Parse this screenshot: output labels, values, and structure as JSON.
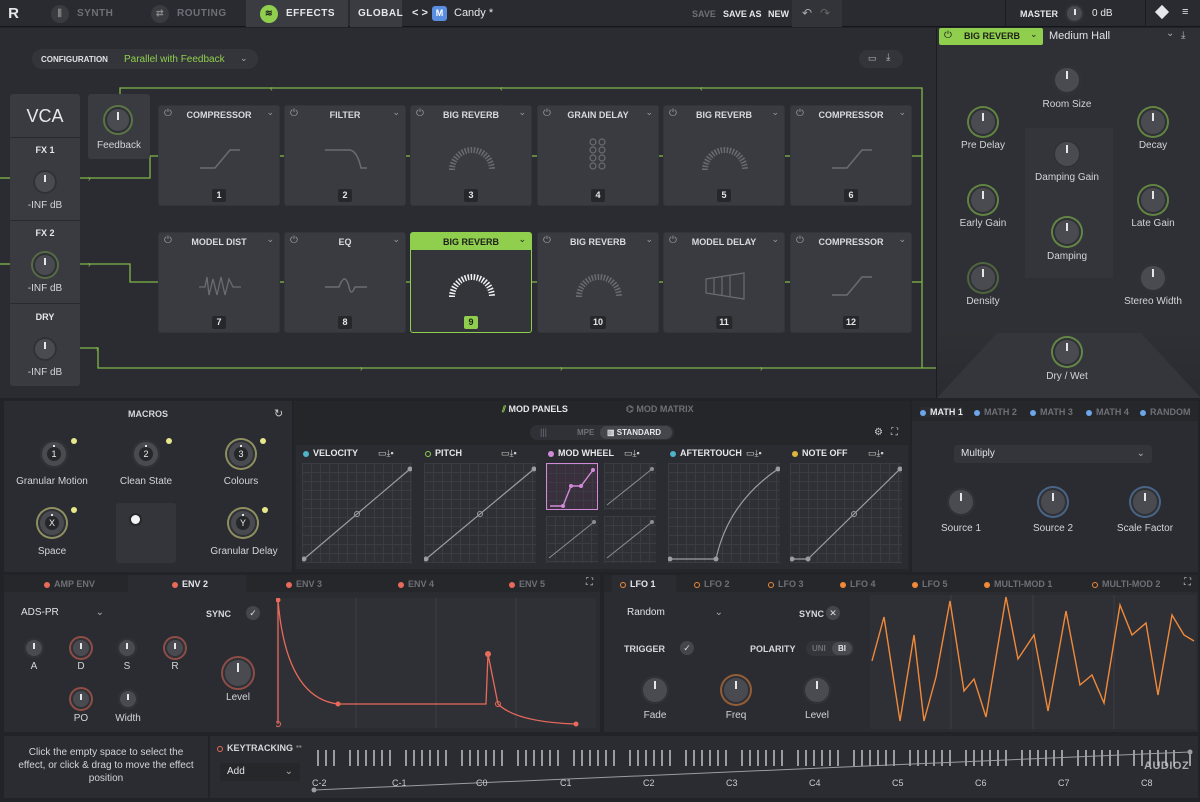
{
  "topbar": {
    "logo": "R",
    "tabs": [
      {
        "label": "SYNTH",
        "icon": "sliders-icon"
      },
      {
        "label": "ROUTING",
        "icon": "routing-icon"
      },
      {
        "label": "EFFECTS",
        "icon": "effects-icon"
      },
      {
        "label": "GLOBAL",
        "icon": ""
      }
    ],
    "nav_arrows": "< >",
    "preset_icon": "M",
    "preset_name": "Candy *",
    "save": "SAVE",
    "save_as": "SAVE AS",
    "new": "NEW",
    "undo": "↶",
    "redo": "↷",
    "master_label": "MASTER",
    "master_value": "0 dB"
  },
  "fx": {
    "configuration_label": "CONFIGURATION",
    "configuration_value": "Parallel with Feedback",
    "vca_title": "VCA",
    "feedback_label": "Feedback",
    "channels": [
      {
        "label": "FX 1",
        "value": "-INF dB"
      },
      {
        "label": "FX 2",
        "value": "-INF dB"
      },
      {
        "label": "DRY",
        "value": "-INF dB"
      }
    ],
    "slots": [
      {
        "name": "COMPRESSOR",
        "num": "1"
      },
      {
        "name": "FILTER",
        "num": "2"
      },
      {
        "name": "BIG REVERB",
        "num": "3"
      },
      {
        "name": "GRAIN DELAY",
        "num": "4"
      },
      {
        "name": "BIG REVERB",
        "num": "5"
      },
      {
        "name": "COMPRESSOR",
        "num": "6"
      },
      {
        "name": "MODEL DIST",
        "num": "7"
      },
      {
        "name": "EQ",
        "num": "8"
      },
      {
        "name": "BIG REVERB",
        "num": "9"
      },
      {
        "name": "BIG REVERB",
        "num": "10"
      },
      {
        "name": "MODEL DELAY",
        "num": "11"
      },
      {
        "name": "COMPRESSOR",
        "num": "12"
      }
    ]
  },
  "reverb": {
    "name": "BIG REVERB",
    "preset": "Medium Hall",
    "knobs": [
      "Room Size",
      "Pre Delay",
      "Decay",
      "Damping Gain",
      "Early Gain",
      "Late Gain",
      "Damping",
      "Density",
      "Stereo Width",
      "Dry / Wet"
    ]
  },
  "macros": {
    "title": "MACROS",
    "items": [
      {
        "badge": "1",
        "label": "Granular Motion"
      },
      {
        "badge": "2",
        "label": "Clean State"
      },
      {
        "badge": "3",
        "label": "Colours"
      },
      {
        "badge": "X",
        "label": "Space"
      },
      {
        "badge": "Y",
        "label": "Granular Delay"
      }
    ]
  },
  "mod": {
    "tab_panels": "MOD PANELS",
    "tab_matrix": "MOD MATRIX",
    "mode_mpe": "MPE",
    "mode_standard": "STANDARD",
    "panels": [
      {
        "label": "VELOCITY",
        "color": "#4fb3c8"
      },
      {
        "label": "PITCH",
        "color": "#8fcf4d"
      },
      {
        "label": "MOD WHEEL",
        "color": "#d28ad8"
      },
      {
        "label": "AFTERTOUCH",
        "color": "#4fb3c8"
      },
      {
        "label": "NOTE OFF",
        "color": "#e0b43c"
      }
    ]
  },
  "math": {
    "tabs": [
      "MATH 1",
      "MATH 2",
      "MATH 3",
      "MATH 4",
      "RANDOM"
    ],
    "operation": "Multiply",
    "knobs": [
      "Source 1",
      "Source 2",
      "Scale Factor"
    ]
  },
  "env": {
    "tabs": [
      "AMP ENV",
      "ENV 2",
      "ENV 3",
      "ENV 4",
      "ENV 5"
    ],
    "mode": "ADS-PR",
    "sync_label": "SYNC",
    "knobs": [
      "A",
      "D",
      "S",
      "R",
      "PO",
      "Width"
    ],
    "level_label": "Level"
  },
  "lfo": {
    "tabs": [
      "LFO 1",
      "LFO 2",
      "LFO 3",
      "LFO 4",
      "LFO 5",
      "MULTI-MOD 1",
      "MULTI-MOD 2"
    ],
    "shape": "Random",
    "sync_label": "SYNC",
    "trigger_label": "TRIGGER",
    "polarity_label": "POLARITY",
    "polarity_uni": "UNI",
    "polarity_bi": "BI",
    "knobs": [
      "Fade",
      "Freq",
      "Level"
    ]
  },
  "hint": "Click the empty space to select the effect, or click & drag to move the effect position",
  "keytracking": {
    "title": "KEYTRACKING",
    "mode": "Add",
    "notes": [
      "C-2",
      "C-1",
      "C0",
      "C1",
      "C2",
      "C3",
      "C4",
      "C5",
      "C6",
      "C7",
      "C8"
    ]
  },
  "watermark": "AUDIOZ",
  "colors": {
    "accent_green": "#8fcf4d",
    "env_red": "#e86a5a",
    "lfo_orange": "#f08a3a",
    "math_blue": "#6aa6e8"
  }
}
